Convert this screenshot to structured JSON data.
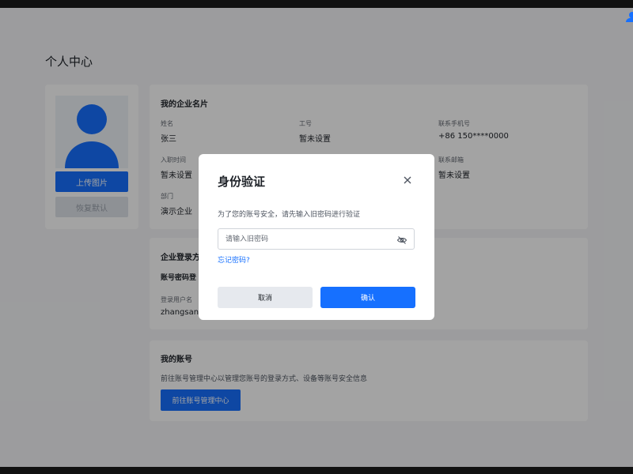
{
  "page": {
    "title": "个人中心"
  },
  "avatar": {
    "upload_label": "上传图片",
    "reset_label": "恢复默认"
  },
  "business_card": {
    "title": "我的企业名片",
    "fields": [
      {
        "label": "姓名",
        "value": "张三"
      },
      {
        "label": "工号",
        "value": "暂未设置"
      },
      {
        "label": "联系手机号",
        "value": "+86 150****0000"
      },
      {
        "label": "入职时间",
        "value": "暂未设置"
      },
      {
        "label": "联系邮箱",
        "value": "暂未设置"
      },
      {
        "label": "部门",
        "value": "演示企业"
      }
    ]
  },
  "login_section": {
    "title": "企业登录方",
    "subtitle": "账号密码登",
    "username_label": "登录用户名",
    "username_value": "zhangsan"
  },
  "my_account": {
    "title": "我的账号",
    "description": "前往账号管理中心以管理您账号的登录方式、设备等账号安全信息",
    "button_label": "前往账号管理中心"
  },
  "modal": {
    "title": "身份验证",
    "description": "为了您的账号安全，请先输入旧密码进行验证",
    "password_placeholder": "请输入旧密码",
    "forgot_label": "忘记密码?",
    "cancel_label": "取消",
    "confirm_label": "确认"
  },
  "icons": {
    "close": "close-icon",
    "eye": "eye-off-icon",
    "avatar": "user-silhouette-icon",
    "user": "user-icon"
  },
  "colors": {
    "accent": "#1670ff",
    "overlay": "rgba(0,0,0,0.36)",
    "page_bg": "#f4f5f7"
  }
}
